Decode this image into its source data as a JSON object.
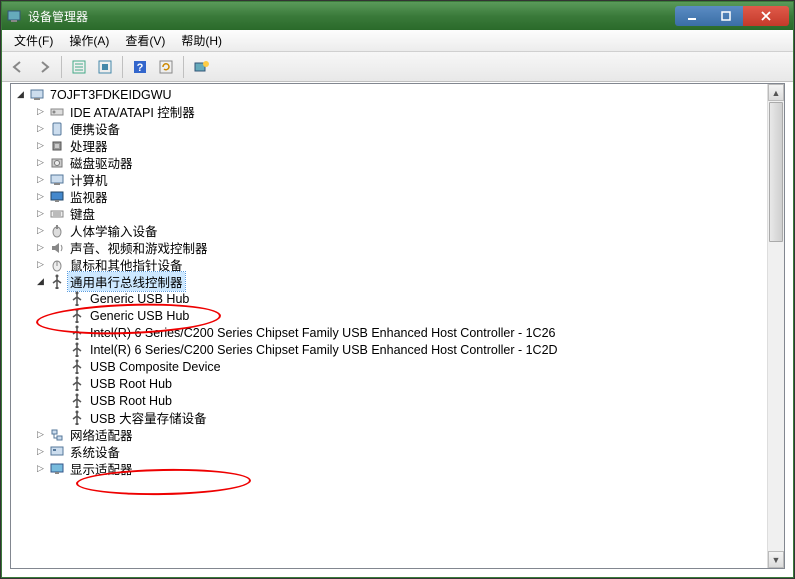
{
  "window": {
    "title": "设备管理器"
  },
  "menu": {
    "file": "文件(F)",
    "action": "操作(A)",
    "view": "查看(V)",
    "help": "帮助(H)"
  },
  "toolbar": {
    "back": "←",
    "forward": "→",
    "prop": "prop",
    "scan": "scan",
    "help": "?",
    "refresh": "refresh",
    "console": "console"
  },
  "tree": {
    "root": {
      "name": "7OJFT3FDKEIDGWU",
      "icon": "computer"
    },
    "nodes": [
      {
        "id": "ide",
        "label": "IDE ATA/ATAPI 控制器",
        "icon": "ide",
        "expander": "closed",
        "indent": 1
      },
      {
        "id": "portable",
        "label": "便携设备",
        "icon": "portable",
        "expander": "closed",
        "indent": 1
      },
      {
        "id": "processor",
        "label": "处理器",
        "icon": "cpu",
        "expander": "closed",
        "indent": 1
      },
      {
        "id": "disk",
        "label": "磁盘驱动器",
        "icon": "disk",
        "expander": "closed",
        "indent": 1
      },
      {
        "id": "computer",
        "label": "计算机",
        "icon": "computer",
        "expander": "closed",
        "indent": 1
      },
      {
        "id": "monitor",
        "label": "监视器",
        "icon": "monitor",
        "expander": "closed",
        "indent": 1
      },
      {
        "id": "keyboard",
        "label": "键盘",
        "icon": "keyboard",
        "expander": "closed",
        "indent": 1
      },
      {
        "id": "hid",
        "label": "人体学输入设备",
        "icon": "hid",
        "expander": "closed",
        "indent": 1
      },
      {
        "id": "sound",
        "label": "声音、视频和游戏控制器",
        "icon": "sound",
        "expander": "closed",
        "indent": 1
      },
      {
        "id": "mouse",
        "label": "鼠标和其他指针设备",
        "icon": "mouse",
        "expander": "closed",
        "indent": 1
      },
      {
        "id": "usb",
        "label": "通用串行总线控制器",
        "icon": "usb",
        "expander": "open",
        "indent": 1,
        "selected": true
      },
      {
        "id": "usb0",
        "label": "Generic USB Hub",
        "icon": "usbdev",
        "expander": "none",
        "indent": 2
      },
      {
        "id": "usb1",
        "label": "Generic USB Hub",
        "icon": "usbdev",
        "expander": "none",
        "indent": 2
      },
      {
        "id": "usb2",
        "label": "Intel(R) 6 Series/C200 Series Chipset Family USB Enhanced Host Controller - 1C26",
        "icon": "usbdev",
        "expander": "none",
        "indent": 2
      },
      {
        "id": "usb3",
        "label": "Intel(R) 6 Series/C200 Series Chipset Family USB Enhanced Host Controller - 1C2D",
        "icon": "usbdev",
        "expander": "none",
        "indent": 2
      },
      {
        "id": "usb4",
        "label": "USB Composite Device",
        "icon": "usbdev",
        "expander": "none",
        "indent": 2
      },
      {
        "id": "usb5",
        "label": "USB Root Hub",
        "icon": "usbdev",
        "expander": "none",
        "indent": 2
      },
      {
        "id": "usb6",
        "label": "USB Root Hub",
        "icon": "usbdev",
        "expander": "none",
        "indent": 2
      },
      {
        "id": "usb7",
        "label": "USB 大容量存储设备",
        "icon": "usbdev",
        "expander": "none",
        "indent": 2
      },
      {
        "id": "network",
        "label": "网络适配器",
        "icon": "network",
        "expander": "closed",
        "indent": 1
      },
      {
        "id": "system",
        "label": "系统设备",
        "icon": "system",
        "expander": "closed",
        "indent": 1
      },
      {
        "id": "display",
        "label": "显示适配器",
        "icon": "display",
        "expander": "closed",
        "indent": 1
      }
    ]
  },
  "annotations": {
    "circle1": "通用串行总线控制器",
    "circle2": "USB 大容量存储设备"
  }
}
